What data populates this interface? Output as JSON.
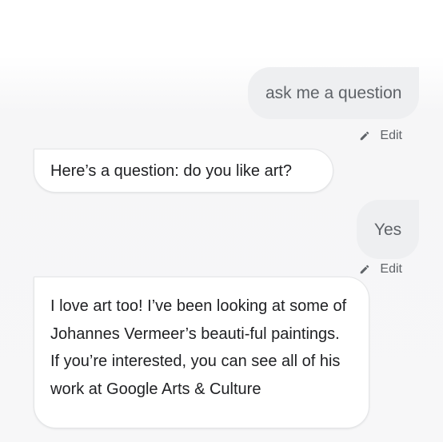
{
  "conversation": {
    "messages": [
      {
        "role": "user",
        "text": "ask me a question",
        "edit_label": "Edit"
      },
      {
        "role": "assistant",
        "text": "Here’s a question: do you like art?"
      },
      {
        "role": "user",
        "text": "Yes",
        "edit_label": "Edit"
      },
      {
        "role": "assistant",
        "text": "I love art too! I’ve been looking at some of Johannes Vermeer’s beauti-ful paintings. If you’re interested, you can see all of his work at Google Arts & Culture"
      }
    ]
  },
  "icons": {
    "edit": "pencil-icon"
  },
  "colors": {
    "user_bubble_bg": "#eeeff1",
    "user_text": "#5f6368",
    "assistant_text": "#202124",
    "edit_text": "#5f6368"
  }
}
